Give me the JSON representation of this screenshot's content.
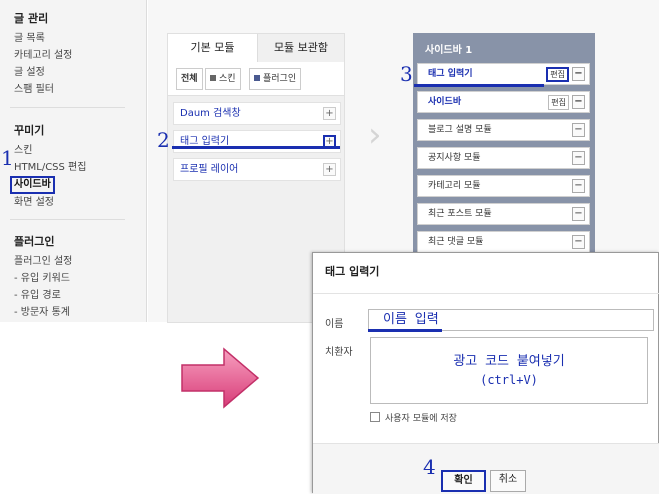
{
  "admin_sidebar": {
    "sections": [
      {
        "title": "글 관리",
        "items": [
          "글 목록",
          "카테고리 설정",
          "글 설정",
          "스팸 필터"
        ]
      },
      {
        "title": "꾸미기",
        "items": [
          "스킨",
          "HTML/CSS 편집",
          "사이드바",
          "화면 설정"
        ]
      },
      {
        "title": "플러그인",
        "items": [
          "플러그인 설정",
          "- 유입 키워드",
          "- 유입 경로",
          "- 방문자 통계"
        ]
      }
    ]
  },
  "steps": [
    "1",
    "2",
    "3",
    "4"
  ],
  "module_panel": {
    "tabs": [
      "기본 모듈",
      "모듈 보관함"
    ],
    "filters": [
      {
        "label": "전체",
        "color": ""
      },
      {
        "label": "스킨",
        "color": "#666666"
      },
      {
        "label": "플러그인",
        "color": "#4a5a90"
      }
    ],
    "modules": [
      "Daum 검색창",
      "태그 입력기",
      "프로필 레이어"
    ],
    "add_symbol": "+"
  },
  "chevron": "›",
  "sidebar_panel": {
    "title": "사이드바 1",
    "edit_label": "편집",
    "remove_symbol": "−",
    "modules": [
      "태그 입력기",
      "사이드바",
      "블로그 설명 모듈",
      "공지사항 모듈",
      "카테고리 모듈",
      "최근 포스트 모듈",
      "최근 댓글 모듈"
    ]
  },
  "dialog": {
    "title": "태그 입력기",
    "name_label": "이름",
    "name_value": "이름 입력",
    "replace_label": "치환자",
    "code_line1": "광고 코드 붙여넣기",
    "code_line2": "(ctrl+V)",
    "save_checkbox": "사용자 모듈에 저장",
    "ok": "확인",
    "cancel": "취소"
  },
  "colors": {
    "highlight": "#1a2fb0",
    "arrow": "#e2508a"
  }
}
